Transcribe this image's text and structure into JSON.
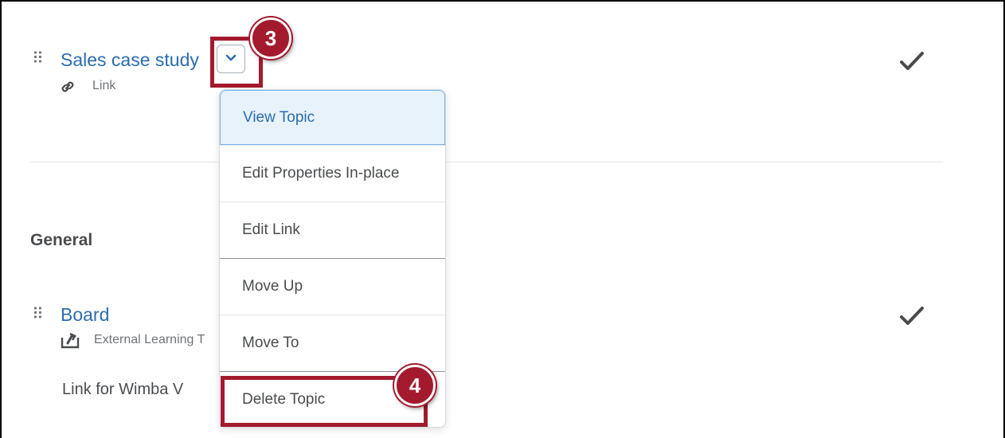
{
  "topics": [
    {
      "title": "Sales case study",
      "type_label": "Link"
    },
    {
      "title": "Board",
      "type_label": "External Learning T",
      "description": "Link for Wimba V"
    }
  ],
  "section": {
    "heading": "General"
  },
  "menu": {
    "items": [
      "View Topic",
      "Edit Properties In-place",
      "Edit Link",
      "Move Up",
      "Move To",
      "Delete Topic"
    ]
  },
  "callouts": {
    "step3": "3",
    "step4": "4"
  },
  "colors": {
    "highlight": "#a31a2e",
    "link": "#2b6cb0",
    "menu_active_bg": "#e8f2fb"
  }
}
